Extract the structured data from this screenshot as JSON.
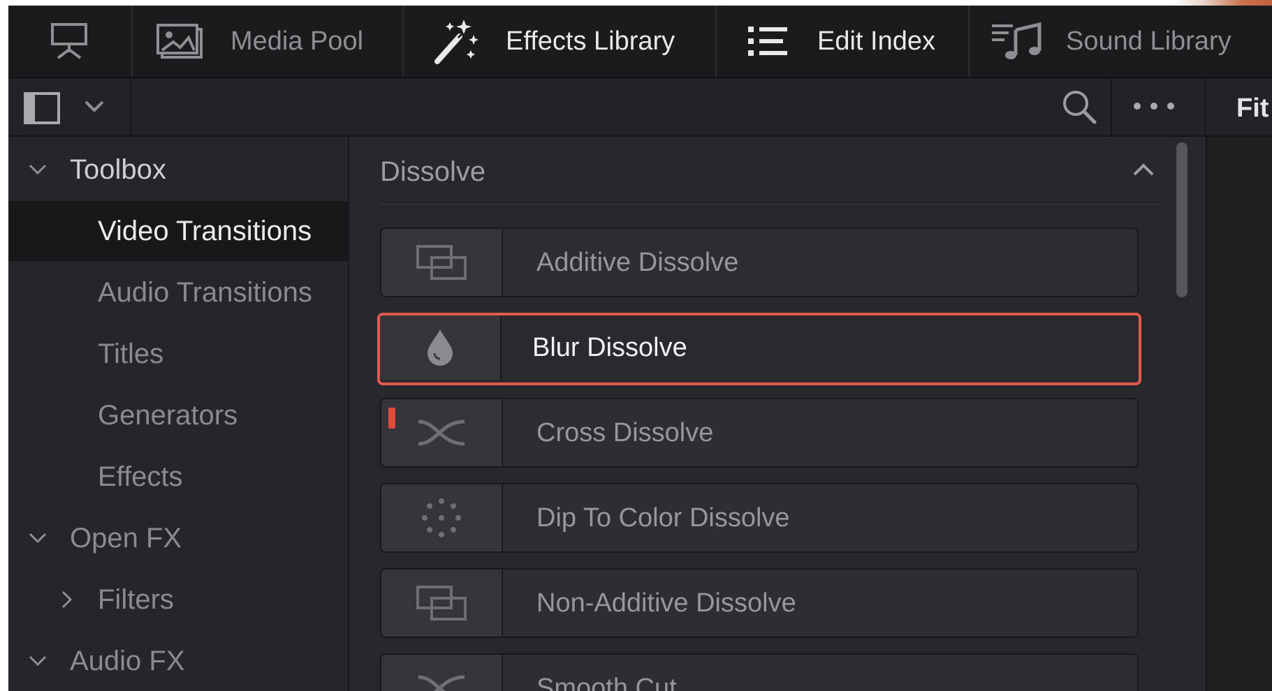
{
  "top_tabs": [
    {
      "label": "",
      "icon": "presentation-icon"
    },
    {
      "label": "Media Pool",
      "icon": "media-pool-icon"
    },
    {
      "label": "Effects Library",
      "icon": "magic-wand-icon"
    },
    {
      "label": "Edit Index",
      "icon": "list-icon"
    },
    {
      "label": "Sound Library",
      "icon": "music-icon"
    }
  ],
  "toolbar": {
    "panel_toggle_icon": "sidebar-toggle-icon",
    "search_icon": "search-icon",
    "more_icon": "more-options-icon",
    "fit_label": "Fit"
  },
  "tree": {
    "items": [
      {
        "label": "Toolbox",
        "type": "section",
        "expanded": true
      },
      {
        "label": "Video Transitions",
        "type": "child",
        "selected": true
      },
      {
        "label": "Audio Transitions",
        "type": "child"
      },
      {
        "label": "Titles",
        "type": "child"
      },
      {
        "label": "Generators",
        "type": "child"
      },
      {
        "label": "Effects",
        "type": "child"
      },
      {
        "label": "Open FX",
        "type": "section",
        "expanded": true
      },
      {
        "label": "Filters",
        "type": "child",
        "expanded": false
      },
      {
        "label": "Audio FX",
        "type": "section",
        "expanded": true
      }
    ]
  },
  "main": {
    "group_title": "Dissolve",
    "items": [
      {
        "label": "Additive Dissolve",
        "icon": "overlap-rectangles-icon"
      },
      {
        "label": "Blur Dissolve",
        "icon": "water-drop-icon",
        "selected": true
      },
      {
        "label": "Cross Dissolve",
        "icon": "cross-arrows-icon",
        "badge": true
      },
      {
        "label": "Dip To Color Dissolve",
        "icon": "dots-circle-icon"
      },
      {
        "label": "Non-Additive Dissolve",
        "icon": "overlap-rectangles-icon"
      },
      {
        "label": "Smooth Cut",
        "icon": "cross-arrows-icon"
      }
    ]
  },
  "colors": {
    "selection_outline": "#e05a4f",
    "badge": "#e04b3e",
    "panel_bg": "#28282c"
  }
}
